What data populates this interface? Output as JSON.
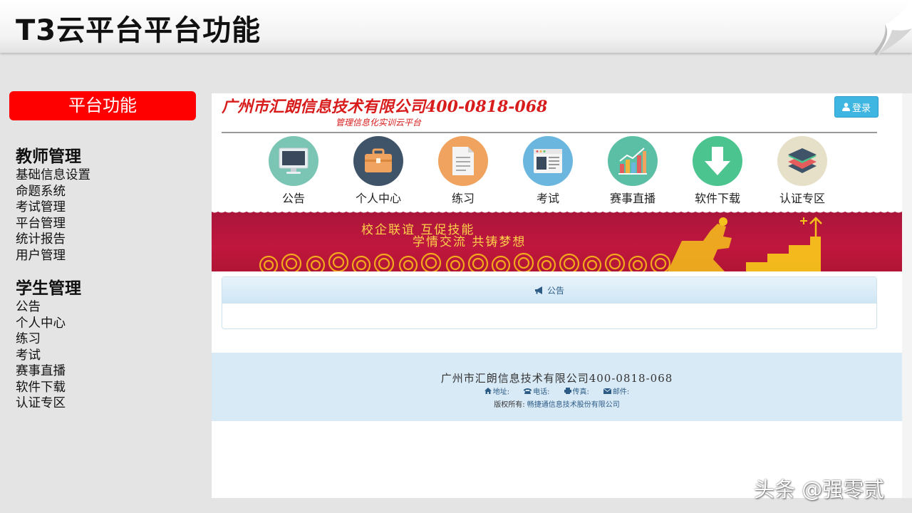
{
  "slide": {
    "title": "T3云平台平台功能"
  },
  "left_panel": {
    "badge": "平台功能",
    "teacher": {
      "heading": "教师管理",
      "items": [
        "基础信息设置",
        "命题系统",
        "考试管理",
        "平台管理",
        "统计报告",
        "用户管理"
      ]
    },
    "student": {
      "heading": "学生管理",
      "items": [
        "公告",
        "个人中心",
        "练习",
        "考试",
        "赛事直播",
        "软件下载",
        "认证专区"
      ]
    }
  },
  "site": {
    "company_title": "广州市汇朗信息技术有限公司400-0818-068",
    "subtitle": "管理信息化实训云平台",
    "login_label": "登录",
    "nav": [
      {
        "label": "公告",
        "icon": "monitor-icon",
        "color": "#7bc5b4"
      },
      {
        "label": "个人中心",
        "icon": "briefcase-icon",
        "color": "#3f5468"
      },
      {
        "label": "练习",
        "icon": "document-icon",
        "color": "#f0a35e"
      },
      {
        "label": "考试",
        "icon": "browser-window-icon",
        "color": "#6bb6de"
      },
      {
        "label": "赛事直播",
        "icon": "bar-chart-icon",
        "color": "#5bbfa5"
      },
      {
        "label": "软件下载",
        "icon": "download-arrow-icon",
        "color": "#4bc48f"
      },
      {
        "label": "认证专区",
        "icon": "layers-icon",
        "color": "#e7e0c8"
      }
    ],
    "banner": {
      "line1": "校企联谊 互促技能",
      "line2": "学情交流 共铸梦想"
    },
    "notice_title": "公告",
    "footer": {
      "company": "广州市汇朗信息技术有限公司400-0818-068",
      "address_label": "地址:",
      "phone_label": "电话:",
      "fax_label": "传真:",
      "email_label": "邮件:",
      "copyright_label": "版权所有:",
      "copyright_owner": "畅捷通信息技术股份有限公司"
    }
  },
  "watermark": "头条 @强零贰"
}
